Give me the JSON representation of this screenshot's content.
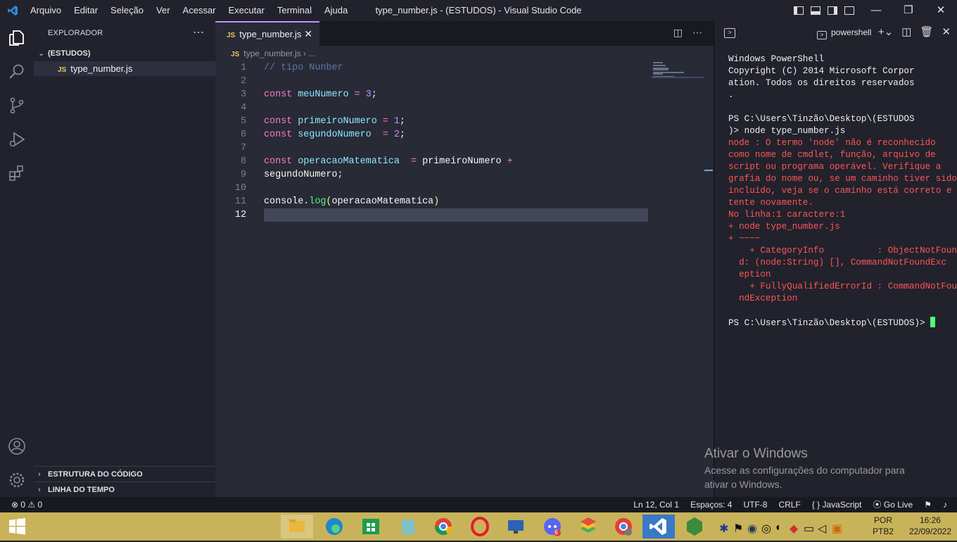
{
  "window": {
    "title": "type_number.js - (ESTUDOS) - Visual Studio Code",
    "menu": [
      "Arquivo",
      "Editar",
      "Seleção",
      "Ver",
      "Acessar",
      "Executar",
      "Terminal",
      "Ajuda"
    ]
  },
  "sidebar": {
    "header": "EXPLORADOR",
    "folder": "(ESTUDOS)",
    "file_icon": "JS",
    "file": "type_number.js",
    "sections": [
      "ESTRUTURA DO CÓDIGO",
      "LINHA DO TEMPO"
    ]
  },
  "editor": {
    "tab_icon": "JS",
    "tab_label": "type_number.js",
    "breadcrumb_file": "type_number.js",
    "breadcrumb_more": "...",
    "line_numbers": [
      "1",
      "2",
      "3",
      "4",
      "5",
      "6",
      "7",
      "8",
      "9",
      "10",
      "11",
      "12"
    ],
    "lines": [
      "// tipo Nunber",
      "",
      "const meuNumero = 3;",
      "",
      "const primeiroNumero = 1;",
      "const segundoNumero  = 2;",
      "",
      "const operacaoMatematica  = primeiroNumero +",
      "segundoNumero;",
      "",
      "console.log(operacaoMatematica)",
      ""
    ]
  },
  "panel": {
    "terminal_name": "powershell",
    "output": [
      {
        "t": "Windows PowerShell",
        "err": false
      },
      {
        "t": "Copyright (C) 2014 Microsoft Corpor",
        "err": false
      },
      {
        "t": "ation. Todos os direitos reservados",
        "err": false
      },
      {
        "t": ".",
        "err": false
      },
      {
        "t": "",
        "err": false
      },
      {
        "t": "PS C:\\Users\\Tinzão\\Desktop\\(ESTUDOS",
        "err": false
      },
      {
        "t": ")> node type_number.js",
        "err": false
      },
      {
        "t": "node : O termo 'node' não é reconhecido",
        "err": true
      },
      {
        "t": "como nome de cmdlet, função, arquivo de",
        "err": true
      },
      {
        "t": "script ou programa operável. Verifique a",
        "err": true
      },
      {
        "t": "grafia do nome ou, se um caminho tiver sido",
        "err": true
      },
      {
        "t": "incluído, veja se o caminho está correto e",
        "err": true
      },
      {
        "t": "tente novamente.",
        "err": true
      },
      {
        "t": "No linha:1 caractere:1",
        "err": true
      },
      {
        "t": "+ node type_number.js",
        "err": true
      },
      {
        "t": "+ ~~~~",
        "err": true
      },
      {
        "t": "    + CategoryInfo          : ObjectNotFoun",
        "err": true
      },
      {
        "t": "  d: (node:String) [], CommandNotFoundExc",
        "err": true
      },
      {
        "t": "  eption",
        "err": true
      },
      {
        "t": "    + FullyQualifiedErrorId : CommandNotFou",
        "err": true
      },
      {
        "t": "  ndException",
        "err": true
      },
      {
        "t": "",
        "err": false
      }
    ],
    "prompt": "PS C:\\Users\\Tinzão\\Desktop\\(ESTUDOS)> "
  },
  "watermark": {
    "title": "Ativar o Windows",
    "line1": "Acesse as configurações do computador para",
    "line2": "ativar o Windows."
  },
  "status": {
    "problems": "⊗ 0 ⚠ 0",
    "position": "Ln 12, Col 1",
    "spaces": "Espaços: 4",
    "encoding": "UTF-8",
    "eol": "CRLF",
    "language": "{ } JavaScript",
    "golive": "Go Live"
  },
  "taskbar": {
    "lang1": "POR",
    "lang2": "PTB2",
    "time": "16:26",
    "date": "22/09/2022",
    "discord_badge": "6"
  },
  "colors": {
    "accent": "#bd93f9",
    "keyword": "#ff79c6",
    "variable": "#8be9fd",
    "number": "#bd93f9",
    "function": "#50fa7b",
    "comment": "#6272a4",
    "error": "#ff5555"
  }
}
